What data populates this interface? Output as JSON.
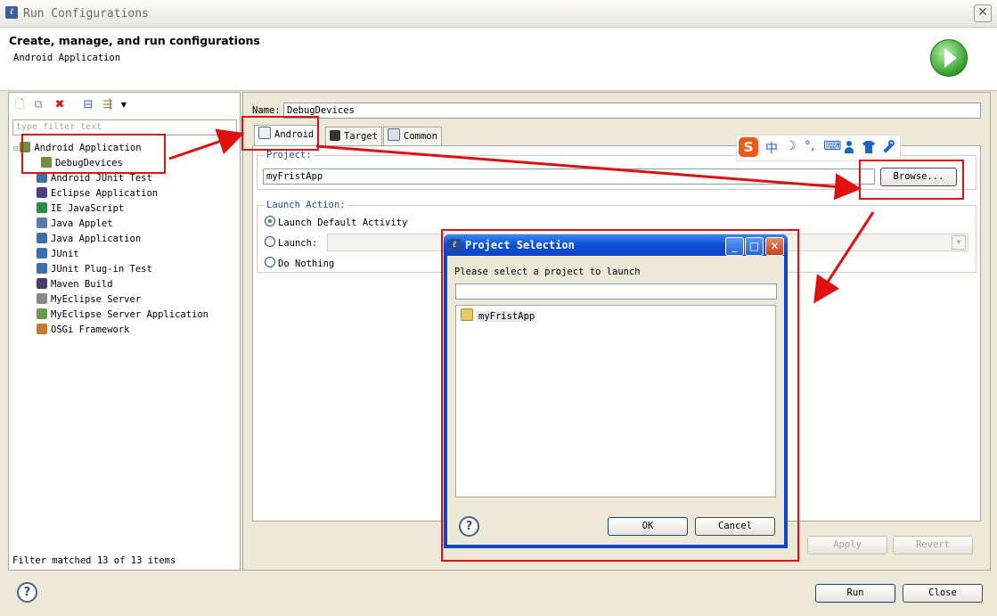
{
  "window": {
    "title": "Run Configurations",
    "close_glyph": "✕"
  },
  "header": {
    "title": "Create, manage, and run configurations",
    "subtitle": "Android Application"
  },
  "left": {
    "toolbar": [
      "new-config-icon",
      "duplicate-icon",
      "delete-icon",
      "collapse-all-icon",
      "filter-icon",
      "dropdown-arrow-icon"
    ],
    "filter_placeholder": "type filter text",
    "tree": [
      {
        "label": "Android Application",
        "expanded": true,
        "icon": "android-app-icon",
        "color": "#6b8f3b",
        "children": [
          {
            "label": "DebugDevices",
            "icon": "android-config-icon",
            "color": "#6b8f3b"
          }
        ]
      },
      {
        "label": "Android JUnit Test",
        "icon": "junit-icon",
        "color": "#3b6fb0"
      },
      {
        "label": "Eclipse Application",
        "icon": "eclipse-icon",
        "color": "#4a3f8f"
      },
      {
        "label": "IE JavaScript",
        "icon": "globe-icon",
        "color": "#2a8a4a"
      },
      {
        "label": "Java Applet",
        "icon": "applet-icon",
        "color": "#5a7ab0"
      },
      {
        "label": "Java Application",
        "icon": "java-app-icon",
        "color": "#3b6fb0"
      },
      {
        "label": "JUnit",
        "icon": "junit-icon",
        "color": "#3b6fb0"
      },
      {
        "label": "JUnit Plug-in Test",
        "icon": "junit-plugin-icon",
        "color": "#3b6fb0"
      },
      {
        "label": "Maven Build",
        "icon": "maven-icon",
        "color": "#4b3a6b"
      },
      {
        "label": "MyEclipse Server",
        "icon": "server-icon",
        "color": "#8a8a8a"
      },
      {
        "label": "MyEclipse Server Application",
        "icon": "server-app-icon",
        "color": "#6a9a4a"
      },
      {
        "label": "OSGi Framework",
        "icon": "osgi-icon",
        "color": "#c87a2a"
      }
    ],
    "status": "Filter matched 13 of 13 items"
  },
  "right": {
    "name_label": "Name:",
    "name_value": "DebugDevices",
    "tabs": [
      "Android",
      "Target",
      "Common"
    ],
    "project_label": "Project:",
    "project_value": "myFristApp",
    "browse_label": "Browse...",
    "launch_label": "Launch Action:",
    "opt_default": "Launch Default Activity",
    "opt_launch": "Launch:",
    "opt_nothing": "Do Nothing",
    "apply": "Apply",
    "revert": "Revert"
  },
  "dialog": {
    "title": "Project Selection",
    "prompt": "Please select a project to launch",
    "items": [
      "myFristApp"
    ],
    "ok": "OK",
    "cancel": "Cancel",
    "help_glyph": "?"
  },
  "footer": {
    "run": "Run",
    "close": "Close",
    "help_glyph": "?"
  },
  "ime": {
    "logo": "S",
    "chars": [
      "中",
      "☽",
      "°,",
      "⌨",
      "👤",
      "👕",
      "🔧"
    ]
  },
  "colors": {
    "annotation_red": "#e01010",
    "dialog_blue": "#0c47c9",
    "run_green": "#2fa02a"
  }
}
